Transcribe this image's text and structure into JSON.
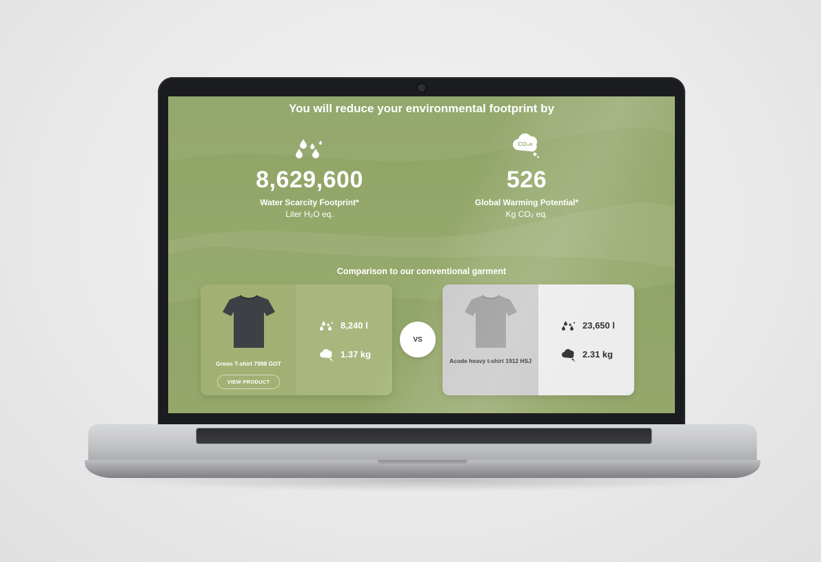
{
  "headline": "You will reduce your environmental footprint by",
  "metrics": {
    "water": {
      "icon": "water-drops-icon",
      "value": "8,629,600",
      "label": "Water Scarcity Footprint*",
      "unit": "Liter H₂O eq."
    },
    "co2": {
      "icon": "co2e-cloud-icon",
      "icon_text": "CO₂e",
      "value": "526",
      "label": "Global Warming Potential*",
      "unit": "Kg CO₂ eq."
    }
  },
  "comparison": {
    "title": "Comparison to our conventional garment",
    "vs_label": "VS",
    "eco_product": {
      "name": "Green T-shirt 7988 GOT",
      "button_label": "VIEW PRODUCT",
      "water": "8,240 l",
      "co2": "1.37 kg",
      "shirt_color": "#3f4046"
    },
    "conventional_product": {
      "name": "Acode heavy t-shirt 1912 HSJ",
      "water": "23,650 l",
      "co2": "2.31 kg",
      "shirt_color": "#9a9a9c"
    }
  },
  "colors": {
    "screen_bg": "#95a86b",
    "eco_card": "#a5b37a",
    "conventional_card": "#e8e8e8"
  }
}
